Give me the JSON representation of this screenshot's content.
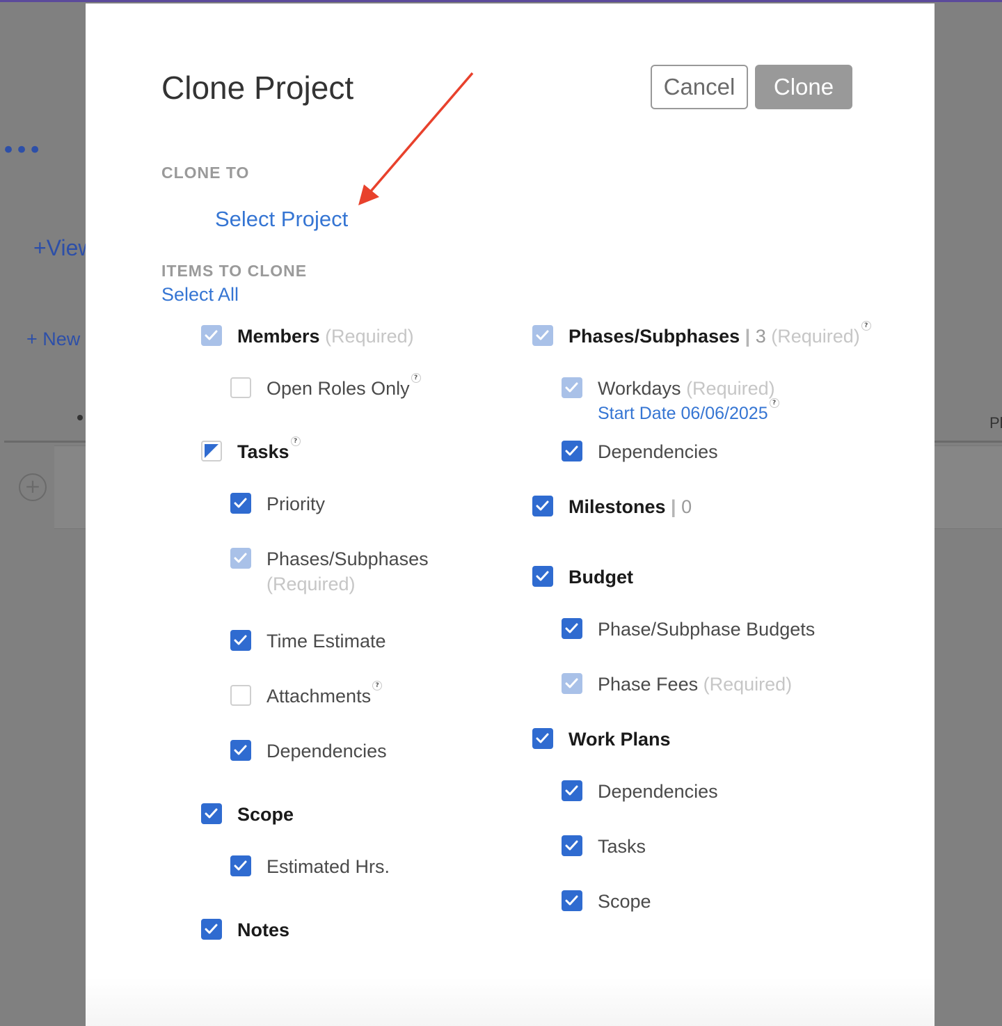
{
  "background": {
    "more": "•••",
    "view_link": "+View",
    "new_link": "+ New",
    "right_cut_text": "Pl",
    "add_button": "+"
  },
  "modal": {
    "title": "Clone Project",
    "cancel_label": "Cancel",
    "clone_label": "Clone",
    "clone_to_label": "CLONE TO",
    "select_project": "Select Project",
    "items_label": "ITEMS TO CLONE",
    "select_all": "Select All",
    "required_text": "(Required)",
    "help_glyph": "?"
  },
  "left_column": [
    {
      "id": "members",
      "label": "Members",
      "state": "disabled",
      "required": true
    },
    {
      "id": "open-roles-only",
      "label": "Open Roles Only",
      "state": "unchecked",
      "help": true
    },
    {
      "id": "tasks",
      "label": "Tasks",
      "state": "partial",
      "help": true
    },
    {
      "id": "priority",
      "label": "Priority",
      "state": "checked"
    },
    {
      "id": "task-phases",
      "label": "Phases/Subphases",
      "state": "disabled",
      "required": true
    },
    {
      "id": "time-estimate",
      "label": "Time Estimate",
      "state": "checked"
    },
    {
      "id": "attachments",
      "label": "Attachments",
      "state": "unchecked",
      "help": true
    },
    {
      "id": "task-dependencies",
      "label": "Dependencies",
      "state": "checked"
    },
    {
      "id": "scope",
      "label": "Scope",
      "state": "checked"
    },
    {
      "id": "estimated-hrs",
      "label": "Estimated Hrs.",
      "state": "checked"
    },
    {
      "id": "notes",
      "label": "Notes",
      "state": "checked"
    }
  ],
  "right_column": [
    {
      "id": "phases",
      "label": "Phases/Subphases",
      "count": "3",
      "state": "disabled",
      "required": true,
      "help": true
    },
    {
      "id": "workdays",
      "label": "Workdays",
      "state": "disabled",
      "required": true,
      "start_date": "Start Date 06/06/2025"
    },
    {
      "id": "phase-dependencies",
      "label": "Dependencies",
      "state": "checked"
    },
    {
      "id": "milestones",
      "label": "Milestones",
      "count": "0",
      "state": "checked"
    },
    {
      "id": "budget",
      "label": "Budget",
      "state": "checked"
    },
    {
      "id": "phase-budgets",
      "label": "Phase/Subphase Budgets",
      "state": "checked"
    },
    {
      "id": "phase-fees",
      "label": "Phase Fees",
      "state": "disabled",
      "required": true
    },
    {
      "id": "work-plans",
      "label": "Work Plans",
      "state": "checked"
    },
    {
      "id": "wp-dependencies",
      "label": "Dependencies",
      "state": "checked"
    },
    {
      "id": "wp-tasks",
      "label": "Tasks",
      "state": "checked"
    },
    {
      "id": "wp-scope",
      "label": "Scope",
      "state": "checked"
    }
  ],
  "colors": {
    "accent": "#3575d3",
    "checkbox_checked": "#2f6bd0",
    "checkbox_disabled": "#a9c1e8",
    "annotation_arrow": "#e8412c"
  }
}
